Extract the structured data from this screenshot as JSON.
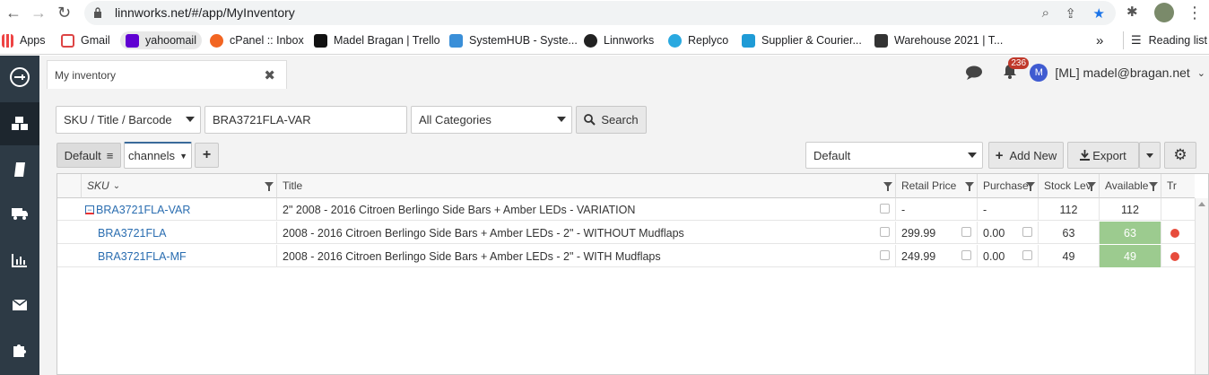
{
  "browser": {
    "url": "linnworks.net/#/app/MyInventory",
    "bookmarks": [
      "Apps",
      "Gmail",
      "yahoomail",
      "cPanel :: Inbox",
      "Madel Bragan | Trello",
      "SystemHUB - Syste...",
      "Linnworks",
      "Replyco",
      "Supplier & Courier...",
      "Warehouse 2021 | T..."
    ],
    "overflow": "»",
    "reading_list": "Reading list"
  },
  "app": {
    "tab_title": "My inventory",
    "notif_count": "236",
    "user_initial": "M",
    "user_label": "[ML] madel@bragan.net",
    "search": {
      "field": "SKU / Title / Barcode",
      "query": "BRA3721FLA-VAR",
      "category": "All Categories",
      "button": "Search"
    },
    "views": {
      "default": "Default",
      "channels": "channels",
      "add": "+"
    },
    "view_select": "Default",
    "add_new": "Add New",
    "export": "Export",
    "columns": [
      "SKU",
      "Title",
      "Retail Price",
      "Purchase",
      "Stock Lev",
      "Available",
      "Tr"
    ],
    "rows": [
      {
        "sku": "BRA3721FLA-VAR",
        "title": "2\" 2008 - 2016 Citroen Berlingo Side Bars + Amber LEDs - VARIATION",
        "retail": "-",
        "purchase": "-",
        "stock": "112",
        "available": "112"
      },
      {
        "sku": "BRA3721FLA",
        "title": "2008 - 2016 Citroen Berlingo Side Bars + Amber LEDs - 2\" - WITHOUT Mudflaps",
        "retail": "299.99",
        "purchase": "0.00",
        "stock": "63",
        "available": "63"
      },
      {
        "sku": "BRA3721FLA-MF",
        "title": "2008 - 2016 Citroen Berlingo Side Bars + Amber LEDs - 2\" - WITH Mudflaps",
        "retail": "249.99",
        "purchase": "0.00",
        "stock": "49",
        "available": "49"
      }
    ]
  },
  "colors": {
    "sidebar": "#2d3a45",
    "link": "#2a6db0",
    "available_green": "#9ccb8f",
    "badge": "#c0392b"
  }
}
